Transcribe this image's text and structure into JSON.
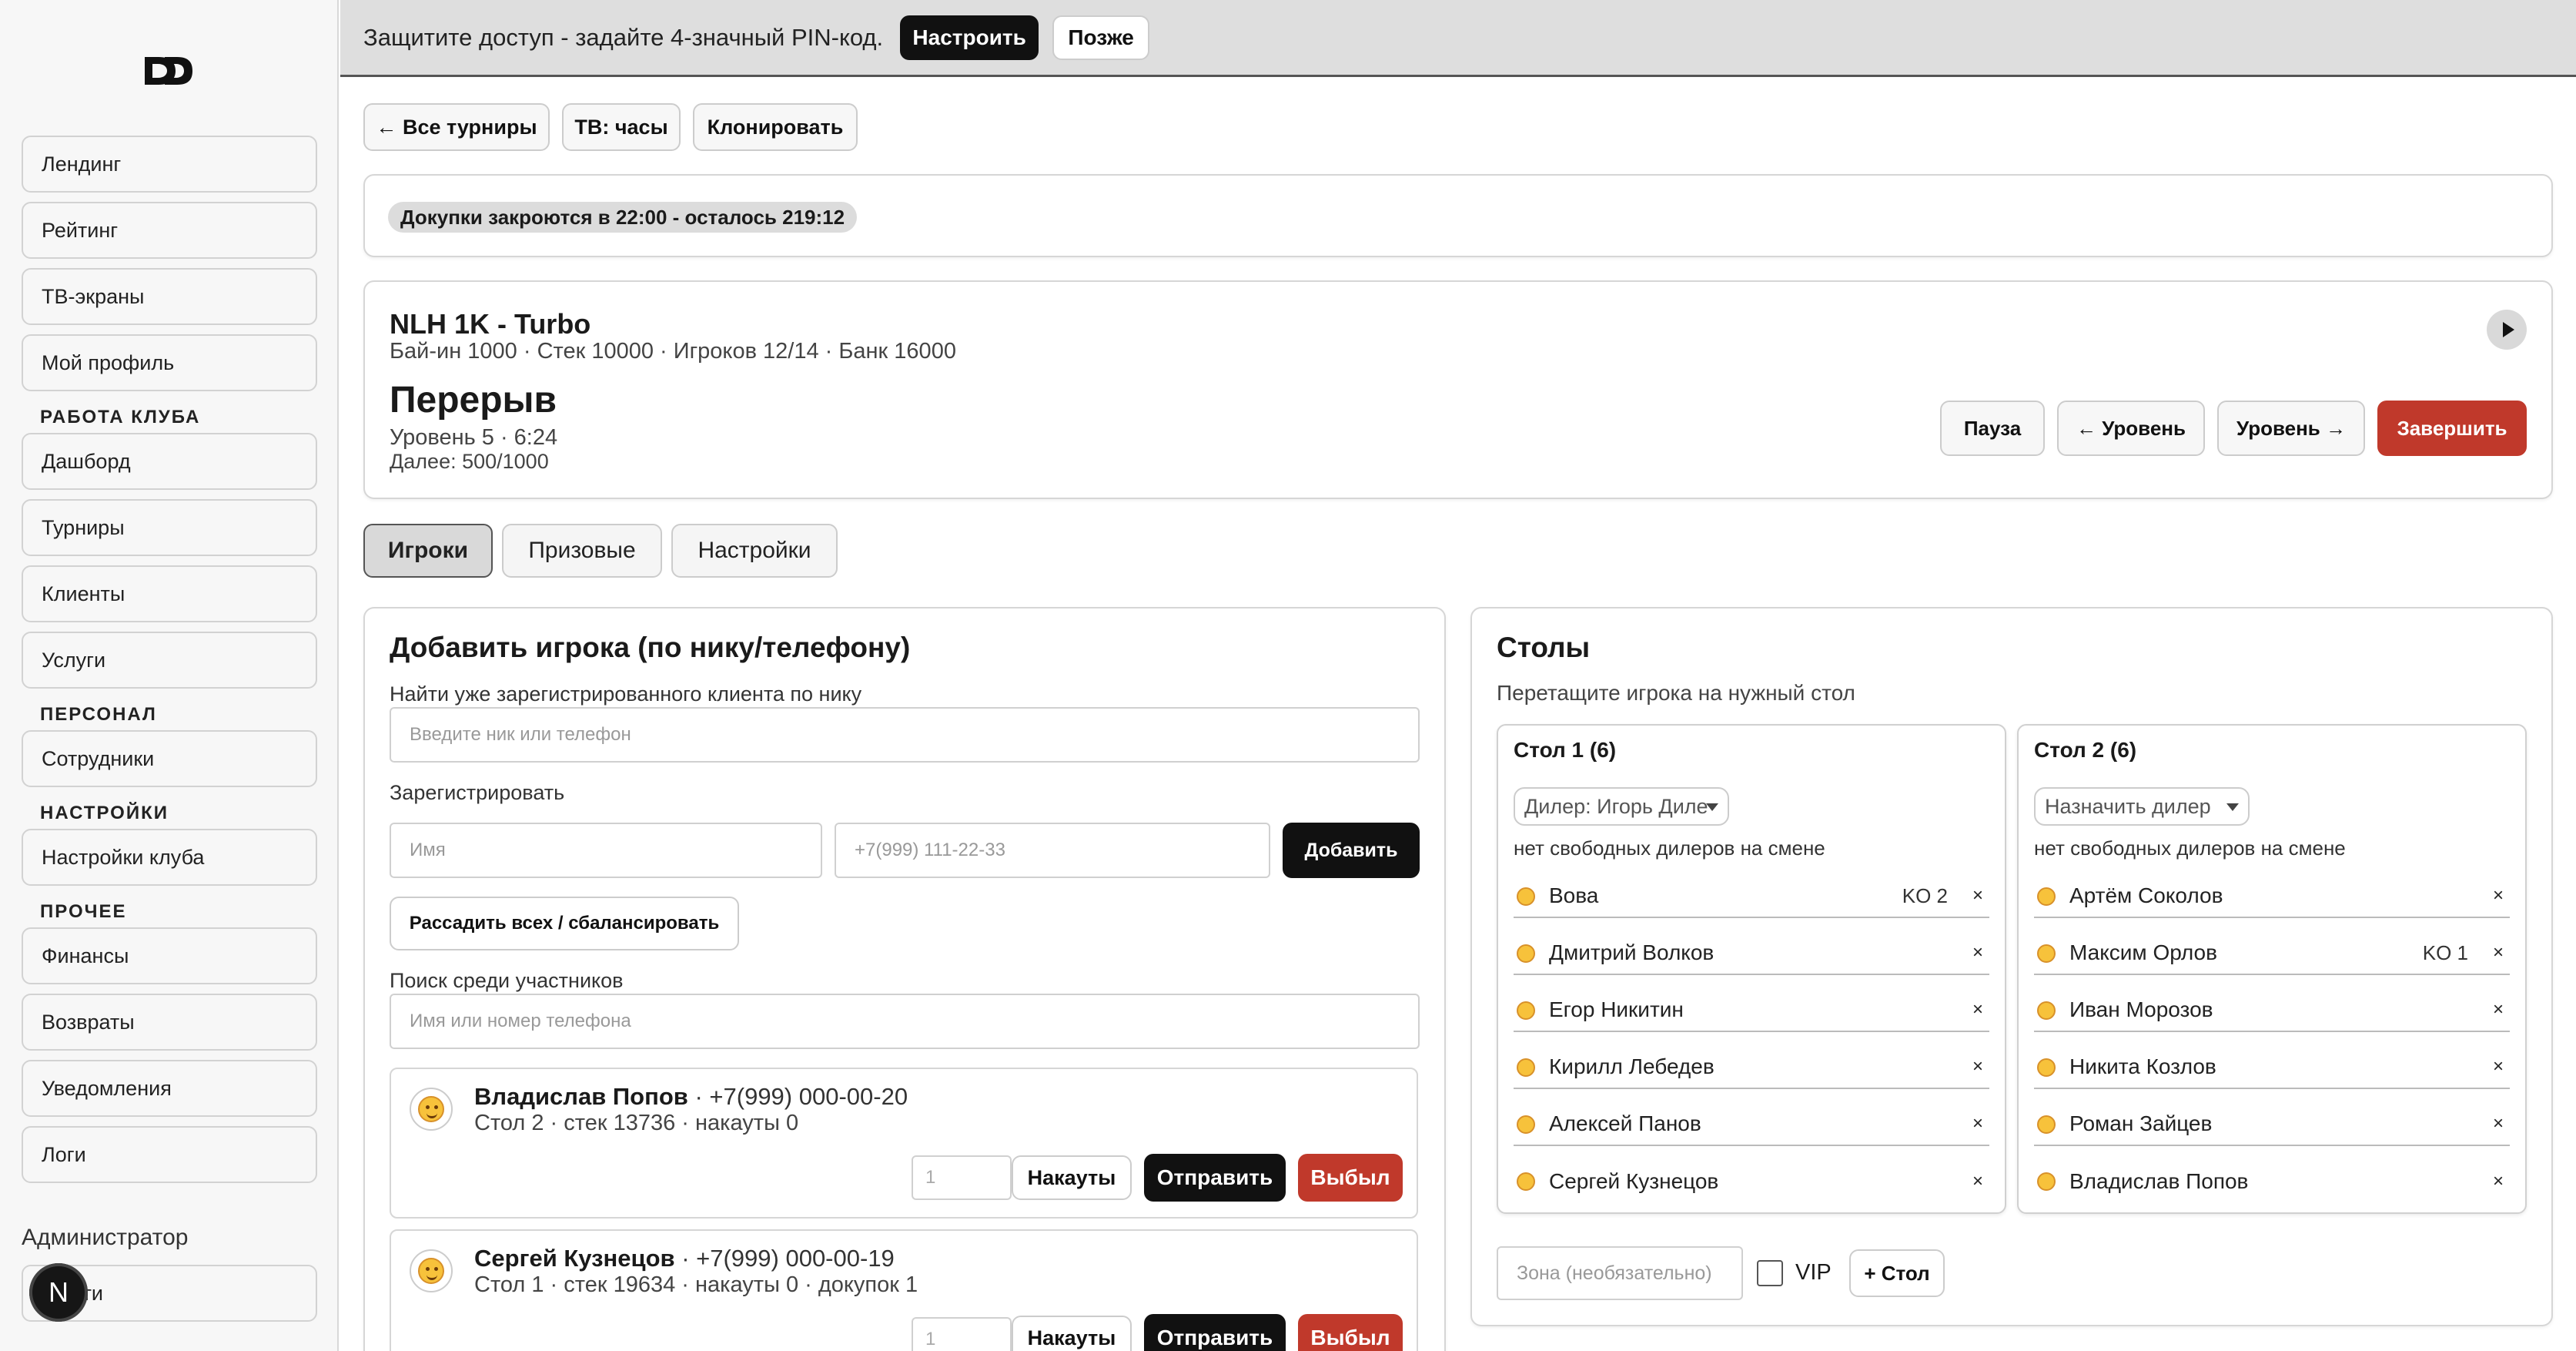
{
  "banner": {
    "text": "Защитите доступ - задайте 4-значный PIN-код.",
    "setup_label": "Настроить",
    "later_label": "Позже"
  },
  "sidebar": {
    "items_top": [
      "Лендинг",
      "Рейтинг",
      "ТВ-экраны",
      "Мой профиль"
    ],
    "section_club": "РАБОТА КЛУБА",
    "items_club": [
      "Дашборд",
      "Турниры",
      "Клиенты",
      "Услуги"
    ],
    "section_staff": "ПЕРСОНАЛ",
    "items_staff": [
      "Сотрудники"
    ],
    "section_settings": "НАСТРОЙКИ",
    "items_settings": [
      "Настройки клуба"
    ],
    "section_other": "ПРОЧЕЕ",
    "items_other": [
      "Финансы",
      "Возвраты",
      "Уведомления",
      "Логи"
    ],
    "role": "Администратор",
    "logout_label": "Выйти",
    "avatar_letter": "N"
  },
  "toolbar": {
    "back_label": "← Все турниры",
    "tv_label": "ТВ: часы",
    "clone_label": "Клонировать"
  },
  "rebuy_info": "Докупки закроются в 22:00 - осталось 219:12",
  "tournament": {
    "name": "NLH 1K - Turbo",
    "meta": "Бай-ин 1000 · Стек 10000 · Игроков 12/14 · Банк 16000",
    "status": "Перерыв",
    "level": "Уровень 5 · 6:24",
    "next": "Далее: 500/1000",
    "pause_label": "Пауза",
    "prev_level_label": "← Уровень",
    "next_level_label": "Уровень →",
    "finish_label": "Завершить"
  },
  "tabs": [
    "Игроки",
    "Призовые",
    "Настройки"
  ],
  "add_player": {
    "title": "Добавить игрока (по нику/телефону)",
    "find_label": "Найти уже зарегистрированного клиента по нику",
    "find_placeholder": "Введите ник или телефон",
    "register_label": "Зарегистрировать",
    "name_placeholder": "Имя",
    "phone_placeholder": "+7(999) 111-22-33",
    "add_label": "Добавить",
    "seat_all_label": "Рассадить всех / сбалансировать",
    "search_label": "Поиск среди участников",
    "search_placeholder": "Имя или номер телефона"
  },
  "players": [
    {
      "name": "Владислав Попов",
      "phone": "· +7(999) 000-00-20",
      "info": "Стол 2 · стек 13736 · накауты 0",
      "qty": "1"
    },
    {
      "name": "Сергей Кузнецов",
      "phone": "· +7(999) 000-00-19",
      "info": "Стол 1 · стек 19634 · накауты 0 · докупок 1",
      "qty": "1"
    }
  ],
  "player_actions": {
    "knockouts_label": "Накауты",
    "send_label": "Отправить",
    "out_label": "Выбыл"
  },
  "tables": {
    "title": "Столы",
    "hint": "Перетащите игрока на нужный стол",
    "no_dealers": "нет свободных дилеров на смене",
    "remove_symbol": "×",
    "list": [
      {
        "name": "Стол 1",
        "count": "(6)",
        "dealer": "Дилер: Игорь Диле",
        "players": [
          {
            "name": "Вова",
            "ko": "KO 2"
          },
          {
            "name": "Дмитрий Волков",
            "ko": ""
          },
          {
            "name": "Егор Никитин",
            "ko": ""
          },
          {
            "name": "Кирилл Лебедев",
            "ko": ""
          },
          {
            "name": "Алексей Панов",
            "ko": ""
          },
          {
            "name": "Сергей Кузнецов",
            "ko": ""
          }
        ]
      },
      {
        "name": "Стол 2",
        "count": "(6)",
        "dealer": "Назначить дилер",
        "players": [
          {
            "name": "Артём Соколов",
            "ko": ""
          },
          {
            "name": "Максим Орлов",
            "ko": "KO 1"
          },
          {
            "name": "Иван Морозов",
            "ko": ""
          },
          {
            "name": "Никита Козлов",
            "ko": ""
          },
          {
            "name": "Роман Зайцев",
            "ko": ""
          },
          {
            "name": "Владислав Попов",
            "ko": ""
          }
        ]
      }
    ],
    "zone_placeholder": "Зона (необязательно)",
    "vip_label": "VIP",
    "add_table_label": "+ Стол"
  },
  "colors": {
    "accent_red": "#c0392b",
    "dark": "#111111"
  }
}
